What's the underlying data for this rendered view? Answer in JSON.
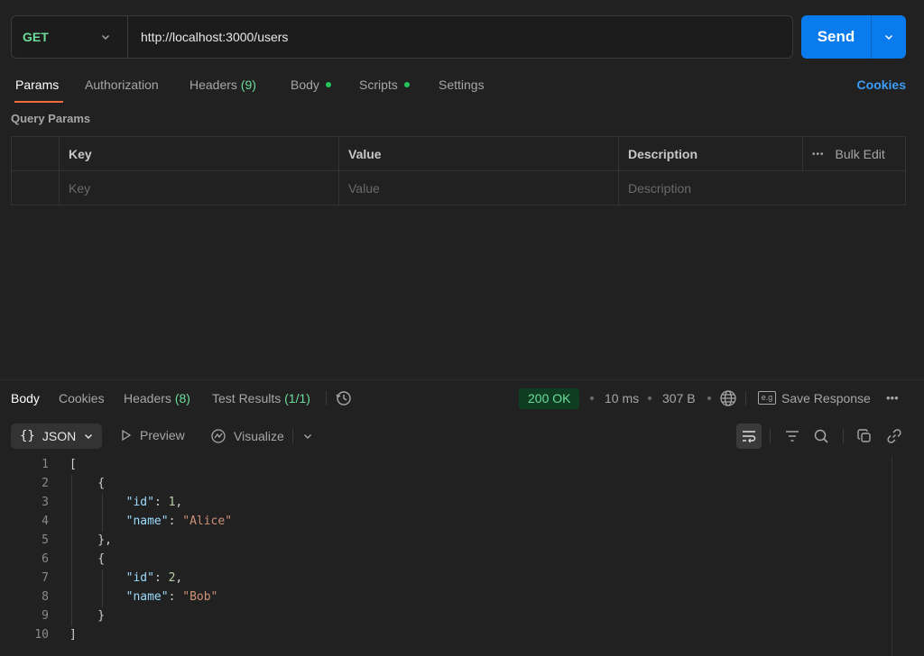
{
  "request": {
    "method": "GET",
    "url": "http://localhost:3000/users",
    "send_label": "Send"
  },
  "request_tabs": {
    "params": "Params",
    "authorization": "Authorization",
    "headers": "Headers",
    "headers_count": "(9)",
    "body": "Body",
    "scripts": "Scripts",
    "settings": "Settings",
    "cookies": "Cookies"
  },
  "query_params": {
    "title": "Query Params",
    "columns": [
      "Key",
      "Value",
      "Description"
    ],
    "bulk_edit": "Bulk Edit",
    "placeholders": {
      "key": "Key",
      "value": "Value",
      "description": "Description"
    }
  },
  "response_tabs": {
    "body": "Body",
    "cookies": "Cookies",
    "headers": "Headers",
    "headers_count": "(8)",
    "test_results": "Test Results",
    "test_results_count": "(1/1)"
  },
  "response_meta": {
    "status": "200 OK",
    "time": "10 ms",
    "size": "307 B",
    "eg_badge": "e.g",
    "save_response": "Save Response",
    "more": "•••"
  },
  "view": {
    "format_icon": "{}",
    "format": "JSON",
    "preview": "Preview",
    "visualize": "Visualize"
  },
  "response_body": {
    "line_numbers": [
      "1",
      "2",
      "3",
      "4",
      "5",
      "6",
      "7",
      "8",
      "9",
      "10"
    ],
    "users": [
      {
        "id_key": "\"id\"",
        "id": "1",
        "name_key": "\"name\"",
        "name": "\"Alice\""
      },
      {
        "id_key": "\"id\"",
        "id": "2",
        "name_key": "\"name\"",
        "name": "\"Bob\""
      }
    ]
  },
  "colors": {
    "accent": "#097bed",
    "method": "#6bdd9a",
    "active_tab_underline": "#f26b3a",
    "status_bg": "#0f3d22",
    "link": "#3d9df5"
  }
}
